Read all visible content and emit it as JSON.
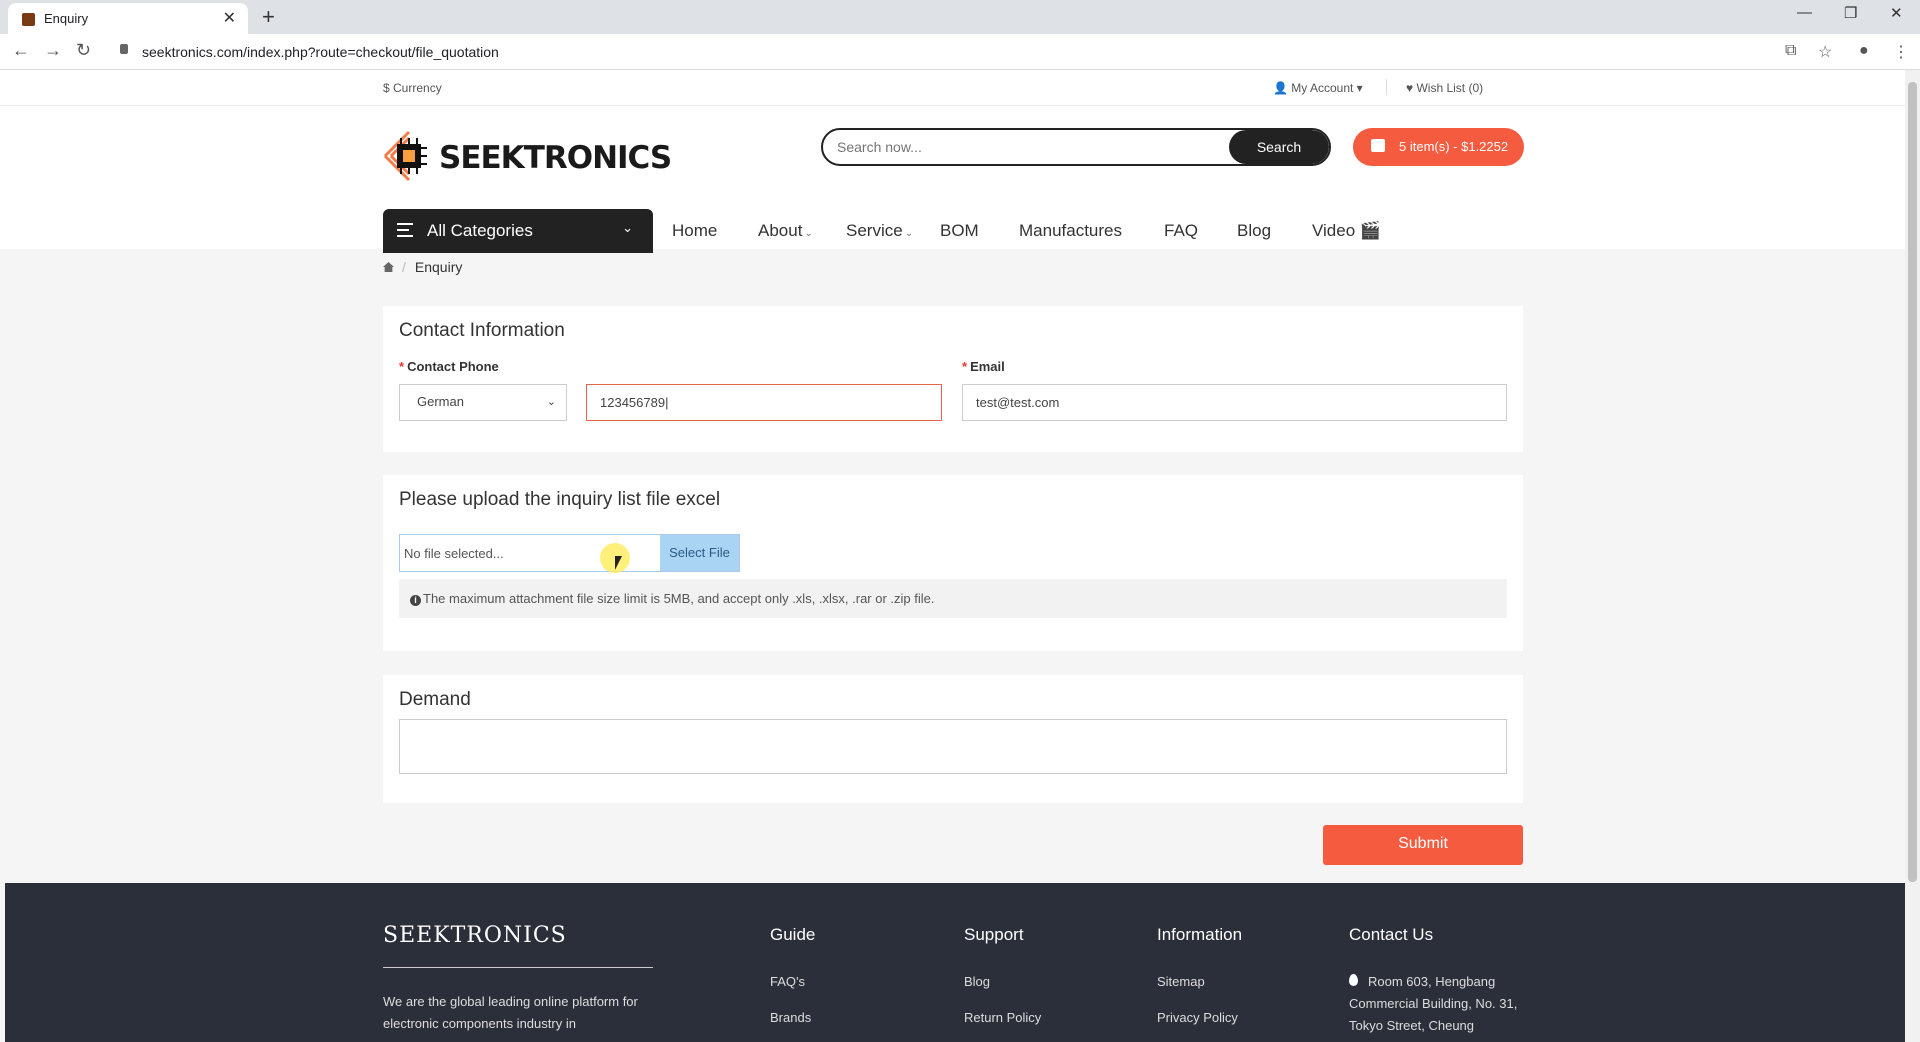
{
  "browser": {
    "tab_title": "Enquiry",
    "url": "seektronics.com/index.php?route=checkout/file_quotation"
  },
  "topbar": {
    "currency": "$ Currency",
    "my_account": "My Account",
    "wish_list": "Wish List (0)"
  },
  "header": {
    "logo_text": "SEEKTRONICS",
    "search_placeholder": "Search now...",
    "search_button": "Search",
    "cart_label": "5 item(s) - $1.2252"
  },
  "nav": {
    "all_categories": "All Categories",
    "items": [
      "Home",
      "About",
      "Service",
      "BOM",
      "Manufactures",
      "FAQ",
      "Blog",
      "Video"
    ]
  },
  "breadcrumb": {
    "current": "Enquiry"
  },
  "contact": {
    "title": "Contact Information",
    "phone_label": "Contact Phone",
    "country_selected": "German",
    "phone_value": "123456789",
    "email_label": "Email",
    "email_value": "test@test.com"
  },
  "upload": {
    "title": "Please upload the inquiry list file excel",
    "file_placeholder": "No file selected...",
    "select_button": "Select File",
    "note": "The maximum attachment file size limit is 5MB, and accept only .xls, .xlsx, .rar or .zip file."
  },
  "demand": {
    "title": "Demand",
    "value": ""
  },
  "submit_label": "Submit",
  "footer": {
    "brand": "SEEKTRONICS",
    "description": "We are the global leading online platform for electronic components industry in",
    "guide": {
      "title": "Guide",
      "links": [
        "FAQ's",
        "Brands"
      ]
    },
    "support": {
      "title": "Support",
      "links": [
        "Blog",
        "Return Policy"
      ]
    },
    "information": {
      "title": "Information",
      "links": [
        "Sitemap",
        "Privacy Policy"
      ]
    },
    "contact": {
      "title": "Contact Us",
      "address": "Room 603, Hengbang Commercial Building, No. 31, Tokyo Street, Cheung"
    }
  },
  "colors": {
    "accent": "#f55b3e",
    "dark": "#222222",
    "footer_bg": "#2a2f3a"
  }
}
